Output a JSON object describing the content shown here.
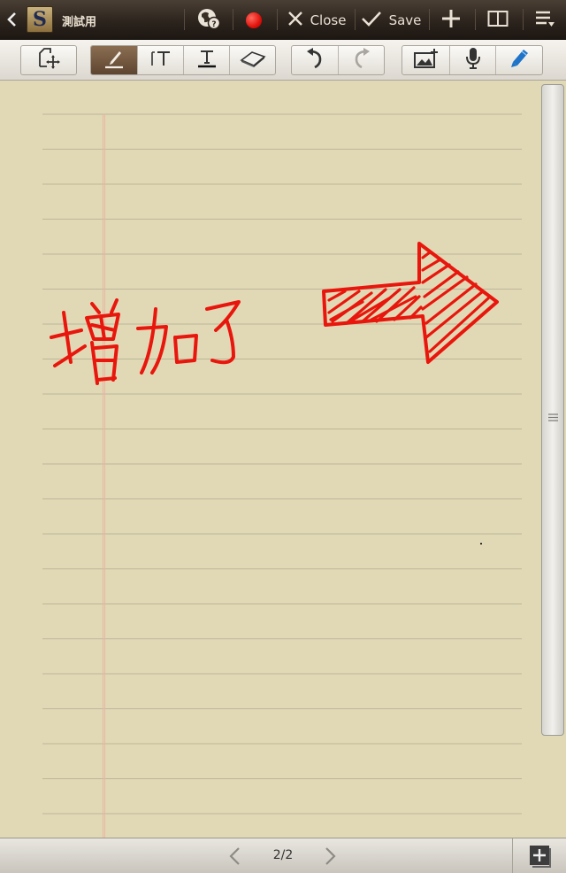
{
  "titlebar": {
    "note_title": "測試用",
    "logo_letter": "S",
    "close_label": "Close",
    "save_label": "Save"
  },
  "icons": {
    "back": "chevron-left-icon",
    "logo": "snote-logo-icon",
    "globe_help": "globe-help-icon",
    "record": "record-icon",
    "close": "close-icon",
    "save": "check-icon",
    "add": "plus-icon",
    "layout": "split-view-icon",
    "menu": "menu-icon",
    "selection": "selection-mode-icon",
    "pen": "pen-icon",
    "text_box": "text-box-icon",
    "text": "text-icon",
    "eraser": "eraser-icon",
    "undo": "undo-icon",
    "redo": "redo-icon",
    "insert_image": "insert-image-icon",
    "voice": "microphone-icon",
    "pen_settings": "pen-settings-icon",
    "prev_page": "chevron-left-icon",
    "next_page": "chevron-right-icon",
    "add_page": "add-page-icon"
  },
  "canvas": {
    "handwriting": "增加了",
    "ink_color": "#e8160c",
    "paper_color": "#e1d9b5",
    "rule_color": "#bdb69a",
    "margin_color": "#e9b6a3"
  },
  "pagination": {
    "current": 2,
    "total": 2,
    "label": "2/2"
  },
  "toolbar": {
    "active_tool": "pen"
  }
}
